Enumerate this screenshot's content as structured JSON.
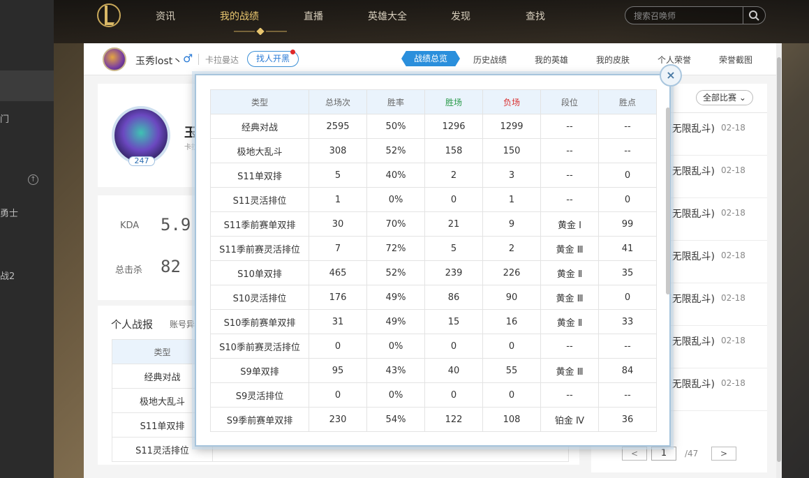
{
  "side_fragments": [
    "门",
    "勇士",
    "战2"
  ],
  "nav": {
    "items": [
      "资讯",
      "我的战绩",
      "直播",
      "英雄大全",
      "发现",
      "查找"
    ],
    "active_index": 1,
    "search_placeholder": "搜索召唤师"
  },
  "profile": {
    "name": "玉秀lost丶",
    "gender": "♂",
    "server": "卡拉曼达",
    "match_button": "找人开黑"
  },
  "tabs": [
    "战绩总览",
    "历史战绩",
    "我的英雄",
    "我的皮肤",
    "个人荣誉",
    "荣誉截图"
  ],
  "hero": {
    "level": "247",
    "name": "玉",
    "sub": "卡拉"
  },
  "stats": {
    "kda_label": "KDA",
    "kda_value": "5.9",
    "kills_label": "总击杀",
    "kills_value": "82"
  },
  "report": {
    "title": "个人战报",
    "subtitle": "账号异",
    "type_header": "类型",
    "rows": [
      "经典对战",
      "极地大乱斗",
      "S11单双排",
      "S11灵活排位"
    ]
  },
  "right": {
    "filter": "全部比赛",
    "matches": [
      {
        "mode": "(无限乱斗)",
        "date": "02-18"
      },
      {
        "mode": "(无限乱斗)",
        "date": "02-18"
      },
      {
        "mode": "(无限乱斗)",
        "date": "02-18"
      },
      {
        "mode": "(无限乱斗)",
        "date": "02-18"
      },
      {
        "mode": "(无限乱斗)",
        "date": "02-18"
      },
      {
        "mode": "(无限乱斗)",
        "date": "02-18"
      },
      {
        "mode": "(无限乱斗)",
        "date": "02-18"
      }
    ],
    "pager": {
      "prev": "<",
      "current": "1",
      "total": "/47",
      "next": ">"
    }
  },
  "popup": {
    "close": "×",
    "headers": [
      "类型",
      "总场次",
      "胜率",
      "胜场",
      "负场",
      "段位",
      "胜点"
    ],
    "rows": [
      [
        "经典对战",
        "2595",
        "50%",
        "1296",
        "1299",
        "--",
        "--"
      ],
      [
        "极地大乱斗",
        "308",
        "52%",
        "158",
        "150",
        "--",
        "--"
      ],
      [
        "S11单双排",
        "5",
        "40%",
        "2",
        "3",
        "--",
        "0"
      ],
      [
        "S11灵活排位",
        "1",
        "0%",
        "0",
        "1",
        "--",
        "0"
      ],
      [
        "S11季前赛单双排",
        "30",
        "70%",
        "21",
        "9",
        "黄金 Ⅰ",
        "99"
      ],
      [
        "S11季前赛灵活排位",
        "7",
        "72%",
        "5",
        "2",
        "黄金 Ⅲ",
        "41"
      ],
      [
        "S10单双排",
        "465",
        "52%",
        "239",
        "226",
        "黄金 Ⅱ",
        "35"
      ],
      [
        "S10灵活排位",
        "176",
        "49%",
        "86",
        "90",
        "黄金 Ⅲ",
        "0"
      ],
      [
        "S10季前赛单双排",
        "31",
        "49%",
        "15",
        "16",
        "黄金 Ⅱ",
        "33"
      ],
      [
        "S10季前赛灵活排位",
        "0",
        "0%",
        "0",
        "0",
        "--",
        "--"
      ],
      [
        "S9单双排",
        "95",
        "43%",
        "40",
        "55",
        "黄金 Ⅲ",
        "84"
      ],
      [
        "S9灵活排位",
        "0",
        "0%",
        "0",
        "0",
        "--",
        "--"
      ],
      [
        "S9季前赛单双排",
        "230",
        "54%",
        "122",
        "108",
        "铂金 Ⅳ",
        "36"
      ]
    ]
  },
  "colors": {
    "accent": "#2a8fdc",
    "win": "#2a9a4a",
    "lose": "#d93030",
    "nav_active": "#e8c66f"
  }
}
